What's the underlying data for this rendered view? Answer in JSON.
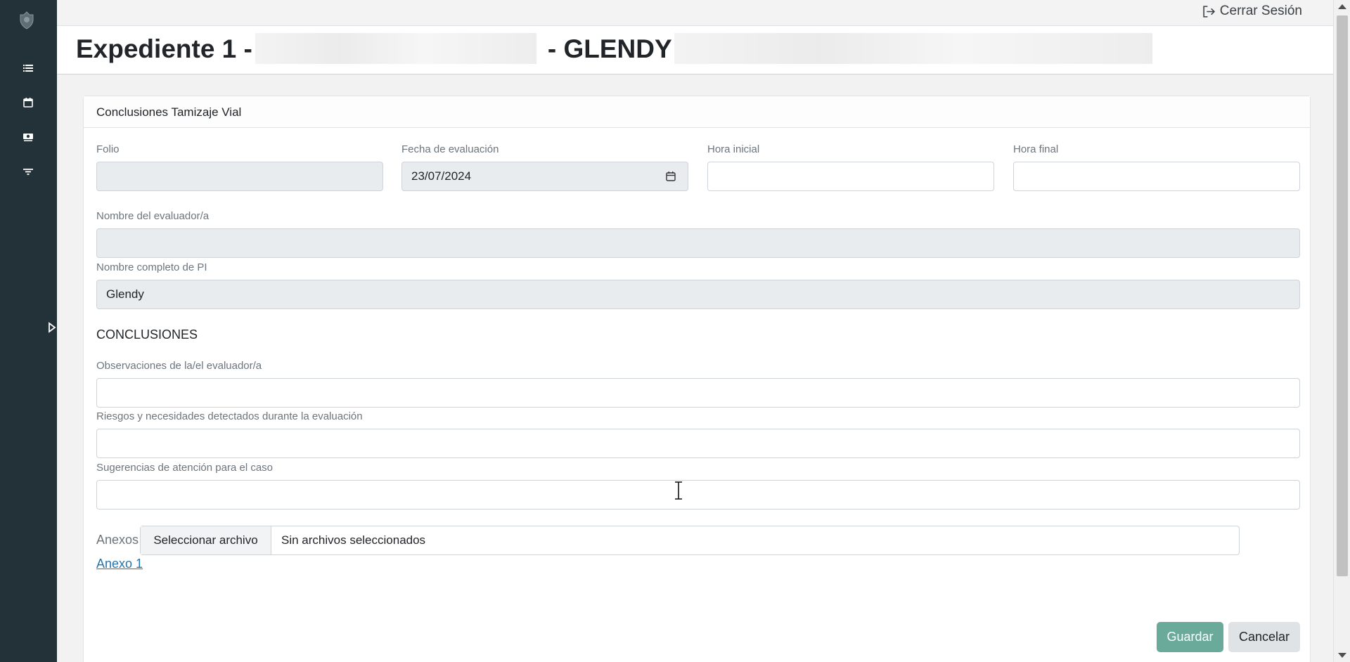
{
  "topbar": {
    "logout_label": "Cerrar Sesión"
  },
  "header": {
    "title_prefix": "Expediente 1 -",
    "title_suffix": "- GLENDY"
  },
  "card": {
    "title": "Conclusiones Tamizaje Vial"
  },
  "form": {
    "folio": {
      "label": "Folio",
      "value": ""
    },
    "fecha": {
      "label": "Fecha de evaluación",
      "value": "23/07/2024"
    },
    "hora_inicial": {
      "label": "Hora inicial",
      "value": ""
    },
    "hora_final": {
      "label": "Hora final",
      "value": ""
    },
    "evaluador": {
      "label": "Nombre del evaluador/a",
      "value": ""
    },
    "nombre_pi": {
      "label": "Nombre completo de PI",
      "value": "Glendy"
    },
    "section_title": "CONCLUSIONES",
    "observaciones": {
      "label": "Observaciones de la/el evaluador/a",
      "value": ""
    },
    "riesgos": {
      "label": "Riesgos y necesidades detectados durante la evaluación",
      "value": ""
    },
    "sugerencias": {
      "label": "Sugerencias de atención para el caso",
      "value": ""
    },
    "anexos": {
      "label": "Anexos",
      "button_label": "Seleccionar archivo",
      "status_text": "Sin archivos seleccionados",
      "link_label": "Anexo 1"
    }
  },
  "actions": {
    "save_label": "Guardar",
    "cancel_label": "Cancelar"
  },
  "colors": {
    "sidebar": "#233239",
    "save_button": "#6aaa9b",
    "link": "#2574a9"
  },
  "icons": {
    "sidebar": [
      "logo-emblem-icon",
      "list-icon",
      "calendar-icon",
      "money-icon",
      "filter-icon",
      "expand-sidebar-icon"
    ],
    "logout": "logout-icon",
    "date_field": "calendar-icon"
  }
}
